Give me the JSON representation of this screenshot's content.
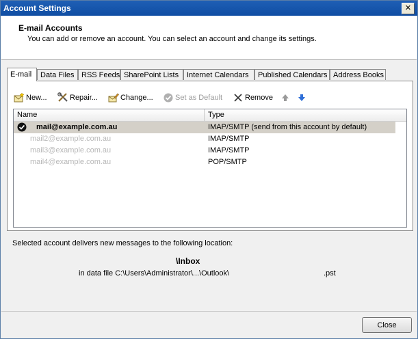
{
  "window": {
    "title": "Account Settings",
    "close_glyph": "✕"
  },
  "header": {
    "title": "E-mail Accounts",
    "subtitle": "You can add or remove an account. You can select an account and change its settings."
  },
  "tabs": [
    {
      "label": "E-mail",
      "active": true
    },
    {
      "label": "Data Files"
    },
    {
      "label": "RSS Feeds"
    },
    {
      "label": "SharePoint Lists"
    },
    {
      "label": "Internet Calendars"
    },
    {
      "label": "Published Calendars"
    },
    {
      "label": "Address Books"
    }
  ],
  "toolbar": {
    "new_label": "New...",
    "repair_label": "Repair...",
    "change_label": "Change...",
    "set_default_label": "Set as Default",
    "remove_label": "Remove"
  },
  "list": {
    "columns": [
      "Name",
      "Type"
    ],
    "rows": [
      {
        "name": "mail@example.com.au",
        "type": "IMAP/SMTP (send from this account by default)",
        "default": true
      },
      {
        "name": "mail2@example.com.au",
        "type": "IMAP/SMTP"
      },
      {
        "name": "mail3@example.com.au",
        "type": "IMAP/SMTP"
      },
      {
        "name": "mail4@example.com.au",
        "type": "POP/SMTP"
      }
    ]
  },
  "delivery": {
    "label": "Selected account delivers new messages to the following location:",
    "folder": "\\Inbox",
    "data_file": "in data file C:\\Users\\Administrator\\...\\Outlook\\",
    "extension": ".pst"
  },
  "footer": {
    "close_label": "Close"
  },
  "colors": {
    "titlebar": "#1555ab",
    "selection": "#d4d0c8",
    "arrow_up": "#9a9a9a",
    "arrow_down": "#2e6fd8"
  }
}
